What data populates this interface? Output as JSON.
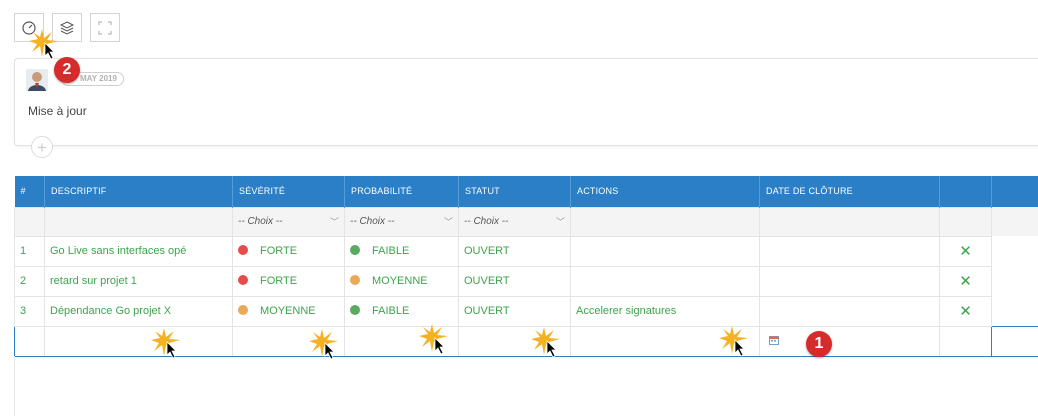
{
  "toolbar": {
    "buttons": [
      {
        "name": "dashboard-button",
        "icon": "gauge-icon"
      },
      {
        "name": "layers-button",
        "icon": "layers-icon"
      },
      {
        "name": "fullscreen-button",
        "icon": "expand-icon"
      }
    ]
  },
  "post": {
    "date_label": "MAY 2019",
    "text": "Mise à jour",
    "add_icon": "plus-circle-icon"
  },
  "table": {
    "headers": [
      "#",
      "DESCRIPTIF",
      "SÉVÉRITÉ",
      "PROBABILITÉ",
      "STATUT",
      "ACTIONS",
      "DATE DE CLÔTURE",
      ""
    ],
    "filter_placeholder": "-- Choix --",
    "rows": [
      {
        "num": "1",
        "desc": "Go Live sans interfaces opé",
        "severity": "FORTE",
        "severity_color": "#e74c4c",
        "probability": "FAIBLE",
        "probability_color": "#5aaa60",
        "status": "OUVERT",
        "actions": "",
        "date": ""
      },
      {
        "num": "2",
        "desc": "retard sur projet 1",
        "severity": "FORTE",
        "severity_color": "#e74c4c",
        "probability": "MOYENNE",
        "probability_color": "#e9a955",
        "status": "OUVERT",
        "actions": "",
        "date": ""
      },
      {
        "num": "3",
        "desc": "Dépendance Go projet X",
        "severity": "MOYENNE",
        "severity_color": "#e9a955",
        "probability": "FAIBLE",
        "probability_color": "#5aaa60",
        "status": "OUVERT",
        "actions": "Accelerer signatures",
        "date": ""
      }
    ],
    "delete_glyph": "✕"
  },
  "annotations": {
    "marker_1": "1",
    "marker_2": "2"
  },
  "colors": {
    "header_bg": "#2a7fc6",
    "text_green": "#3fa34d",
    "marker_red": "#d62b2b"
  }
}
